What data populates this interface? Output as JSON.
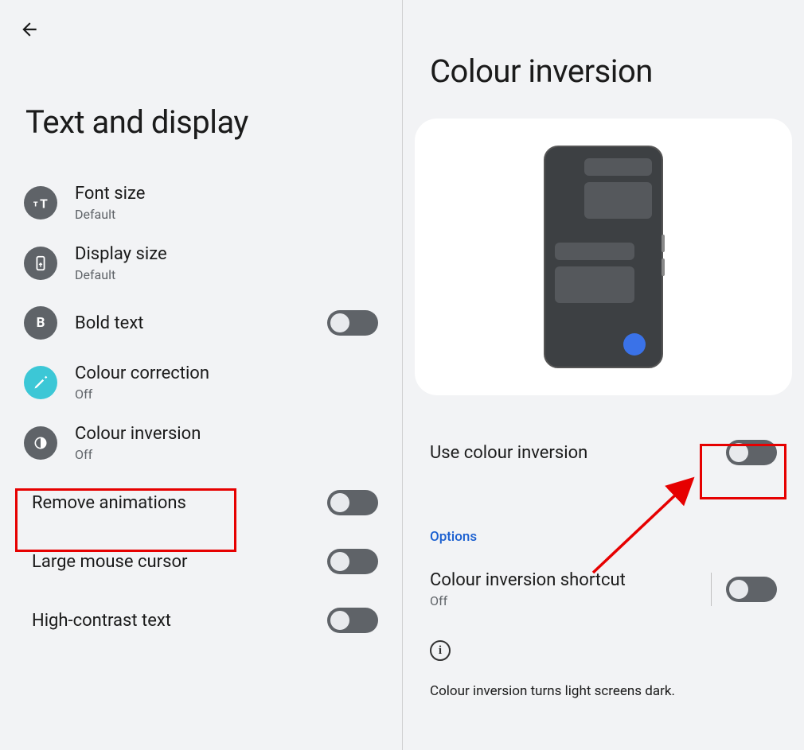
{
  "left": {
    "title": "Text and display",
    "items": [
      {
        "title": "Font size",
        "sub": "Default"
      },
      {
        "title": "Display size",
        "sub": "Default"
      },
      {
        "title": "Bold text"
      },
      {
        "title": "Colour correction",
        "sub": "Off"
      },
      {
        "title": "Colour inversion",
        "sub": "Off"
      },
      {
        "title": "Remove animations"
      },
      {
        "title": "Large mouse cursor"
      },
      {
        "title": "High-contrast text"
      }
    ]
  },
  "right": {
    "title": "Colour inversion",
    "use_label": "Use colour inversion",
    "options_label": "Options",
    "shortcut_title": "Colour inversion shortcut",
    "shortcut_sub": "Off",
    "info_text": "Colour inversion turns light screens dark."
  }
}
